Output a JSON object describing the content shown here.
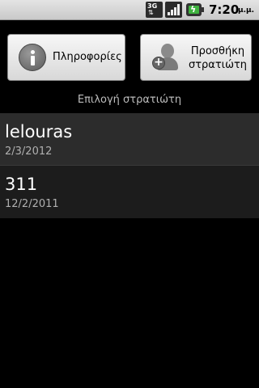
{
  "status_bar": {
    "network_label": "3G",
    "time": "7:20",
    "ampm": "μ.μ.",
    "icons": [
      "3g-data-icon",
      "signal-strength-icon",
      "battery-charging-icon"
    ]
  },
  "buttons": {
    "info_label": "Πληροφορίες",
    "add_soldier_label_line1": "Προσθήκη",
    "add_soldier_label_line2": "στρατιώτη",
    "info_icon": "info-icon",
    "add_icon": "add-user-icon"
  },
  "section": {
    "header": "Επιλογή στρατιώτη"
  },
  "soldiers": [
    {
      "name": "lelouras",
      "date": "2/3/2012"
    },
    {
      "name": "311",
      "date": "12/2/2011"
    }
  ],
  "colors": {
    "background": "#000000",
    "status_bar": "#d6d6d6",
    "button": "#e8e8e8",
    "list_selected": "#2c2c2c",
    "list_normal": "#1c1c1c",
    "header_text": "#bdbdbd",
    "battery_fill": "#3fb23f"
  }
}
